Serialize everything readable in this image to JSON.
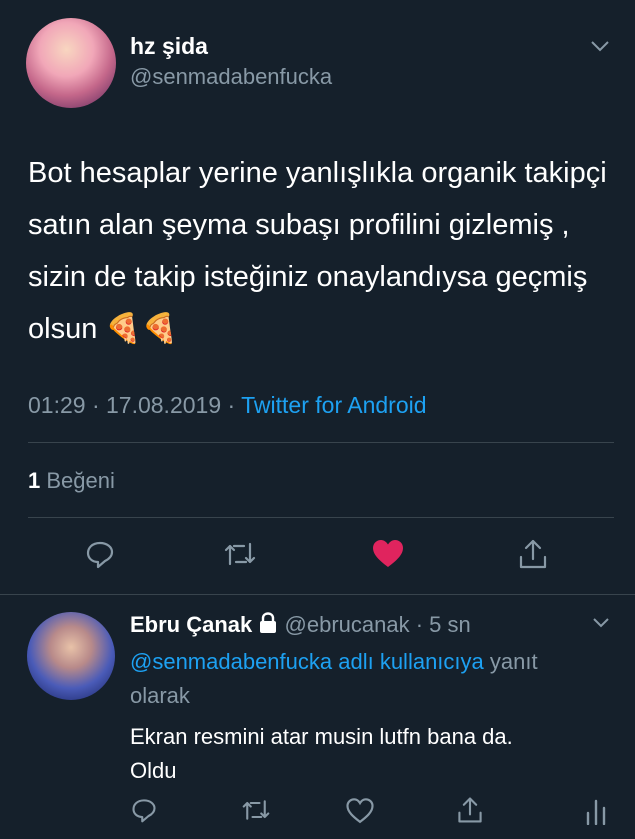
{
  "tweet": {
    "author_name": "hz şida",
    "author_handle": "@senmadabenfucka",
    "text": "Bot hesaplar yerine yanlışlıkla organik takipçi satın alan şeyma subaşı profilini gizlemiş , sizin de takip isteğiniz onaylandıysa geçmiş olsun 🍕🍕",
    "time": "01:29 · 17.08.2019 ·",
    "source": "Twitter for Android",
    "likes_count": "1",
    "likes_label": "Beğeni"
  },
  "reply": {
    "author_name": "Ebru Çanak",
    "author_handle": "@ebrucanak",
    "time_ago": "· 5 sn",
    "reply_to": "@senmadabenfucka adlı kullanıcıya",
    "reply_suffix": " yanıt",
    "reply_suffix2": "olarak",
    "text_line1": "Ekran resmini atar musin lutfn bana da.",
    "text_line2": "Oldu"
  },
  "colors": {
    "background": "#15202b",
    "secondary_text": "#8899a6",
    "link": "#1da1f2",
    "like_active": "#e0245e"
  },
  "icons": [
    "chevron-down-icon",
    "reply-icon",
    "retweet-icon",
    "heart-icon",
    "share-icon",
    "lock-icon",
    "analytics-icon"
  ]
}
